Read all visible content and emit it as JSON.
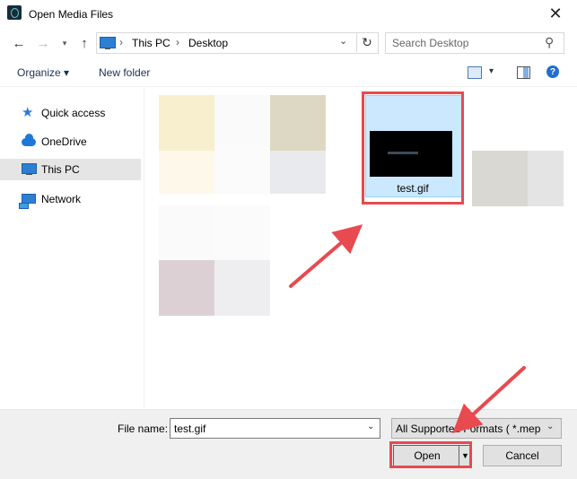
{
  "window": {
    "title": "Open Media Files"
  },
  "address": {
    "crumbs": [
      "This PC",
      "Desktop"
    ]
  },
  "search": {
    "placeholder": "Search Desktop"
  },
  "toolbar": {
    "organize": "Organize ▾",
    "new_folder": "New folder"
  },
  "sidebar": {
    "items": [
      {
        "label": "Quick access",
        "icon": "star-icon"
      },
      {
        "label": "OneDrive",
        "icon": "cloud-icon"
      },
      {
        "label": "This PC",
        "icon": "computer-icon",
        "selected": true
      },
      {
        "label": "Network",
        "icon": "network-icon"
      }
    ]
  },
  "files": {
    "selected_name": "test.gif"
  },
  "footer": {
    "file_name_label": "File name:",
    "file_name_value": "test.gif",
    "file_type": "All Supported Formats ( *.mep",
    "open_label": "Open",
    "cancel_label": "Cancel"
  },
  "colors": {
    "highlight_red": "#e84a4f",
    "selection": "#cce8ff",
    "accent": "#0078d7"
  }
}
